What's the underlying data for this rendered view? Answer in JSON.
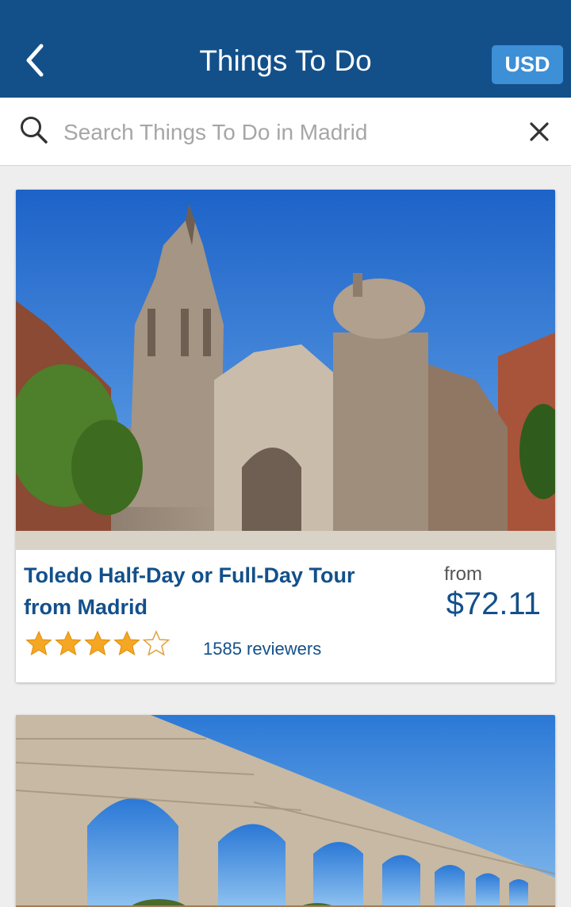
{
  "header": {
    "title": "Things To Do",
    "currency_label": "USD"
  },
  "search": {
    "placeholder": "Search Things To Do in Madrid",
    "value": ""
  },
  "colors": {
    "header_bg": "#13508a",
    "currency_bg": "#3d8fd6",
    "link_blue": "#13508a",
    "star_fill": "#f5a623"
  },
  "listings": [
    {
      "title": "Toledo Half-Day or Full-Day Tour from Madrid",
      "price_prefix": "from",
      "price": "$72.11",
      "rating": 4,
      "rating_max": 5,
      "reviews": "1585 reviewers",
      "image": "cathedral-photo"
    },
    {
      "image": "aqueduct-photo"
    }
  ]
}
